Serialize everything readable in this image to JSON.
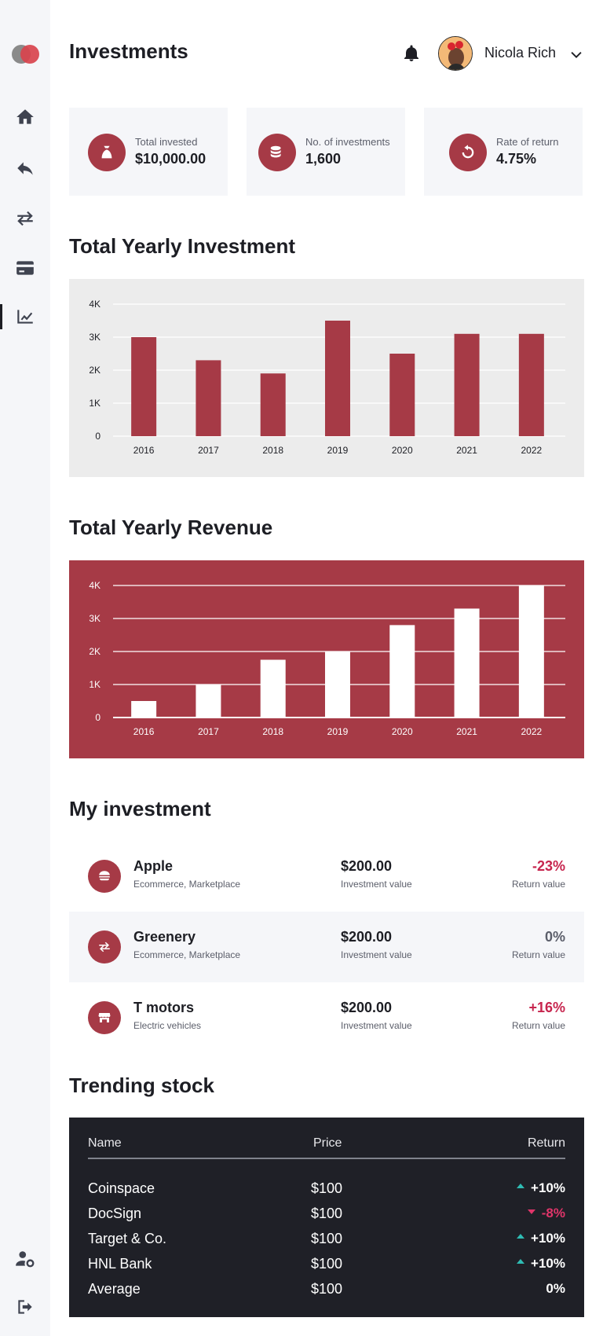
{
  "header": {
    "title": "Investments",
    "user_name": "Nicola Rich"
  },
  "stats": [
    {
      "label": "Total invested",
      "value": "$10,000.00",
      "icon": "money-bag-icon"
    },
    {
      "label": "No. of investments",
      "value": "1,600",
      "icon": "coins-icon"
    },
    {
      "label": "Rate of return",
      "value": "4.75%",
      "icon": "rotate-icon"
    }
  ],
  "sections": {
    "yearly_investment": "Total Yearly Investment",
    "yearly_revenue": "Total Yearly Revenue",
    "my_investment": "My investment",
    "trending": "Trending stock"
  },
  "chart_data": [
    {
      "type": "bar",
      "categories": [
        "2016",
        "2017",
        "2018",
        "2019",
        "2020",
        "2021",
        "2022"
      ],
      "values": [
        3000,
        2300,
        1900,
        3500,
        2500,
        3100,
        3100
      ],
      "yticks": [
        "0",
        "1K",
        "2K",
        "3K",
        "4K"
      ],
      "ylim": [
        0,
        4000
      ],
      "title": "",
      "grid": true,
      "colors": {
        "bar": "#a63a46",
        "background": "#ececec"
      }
    },
    {
      "type": "bar",
      "categories": [
        "2016",
        "2017",
        "2018",
        "2019",
        "2020",
        "2021",
        "2022"
      ],
      "values": [
        500,
        1000,
        1750,
        2000,
        2800,
        3300,
        4000
      ],
      "yticks": [
        "0",
        "1K",
        "2K",
        "3K",
        "4K"
      ],
      "ylim": [
        0,
        4000
      ],
      "title": "",
      "grid": true,
      "colors": {
        "bar": "#ffffff",
        "background": "#a63a46"
      }
    }
  ],
  "investments": [
    {
      "name": "Apple",
      "category": "Ecommerce, Marketplace",
      "value": "$200.00",
      "value_label": "Investment value",
      "return": "-23%",
      "return_label": "Return value",
      "return_color": "#c7254e",
      "icon": "burger-icon"
    },
    {
      "name": "Greenery",
      "category": "Ecommerce, Marketplace",
      "value": "$200.00",
      "value_label": "Investment value",
      "return": "0%",
      "return_label": "Return value",
      "return_color": "#5b5e6a",
      "icon": "exchange-icon"
    },
    {
      "name": "T motors",
      "category": "Electric vehicles",
      "value": "$200.00",
      "value_label": "Investment value",
      "return": "+16%",
      "return_label": "Return value",
      "return_color": "#c7254e",
      "icon": "store-icon"
    }
  ],
  "trending": {
    "headers": {
      "name": "Name",
      "price": "Price",
      "return": "Return"
    },
    "rows": [
      {
        "name": "Coinspace",
        "price": "$100",
        "return": "+10%",
        "trend": "up"
      },
      {
        "name": "DocSign",
        "price": "$100",
        "return": "-8%",
        "trend": "down"
      },
      {
        "name": "Target & Co.",
        "price": "$100",
        "return": "+10%",
        "trend": "up"
      },
      {
        "name": "HNL Bank",
        "price": "$100",
        "return": "+10%",
        "trend": "up"
      },
      {
        "name": "Average",
        "price": "$100",
        "return": "0%",
        "trend": "flat"
      }
    ]
  },
  "sidebar": {
    "items": [
      "home-icon",
      "reply-icon",
      "transfer-icon",
      "credit-card-icon",
      "chart-line-icon"
    ],
    "active": "chart-line-icon",
    "bottom": [
      "user-settings-icon",
      "logout-icon"
    ]
  },
  "colors": {
    "accent": "#a63a46",
    "positive": "#2fbcb4",
    "negative": "#e0356a",
    "dark": "#1f2027"
  }
}
